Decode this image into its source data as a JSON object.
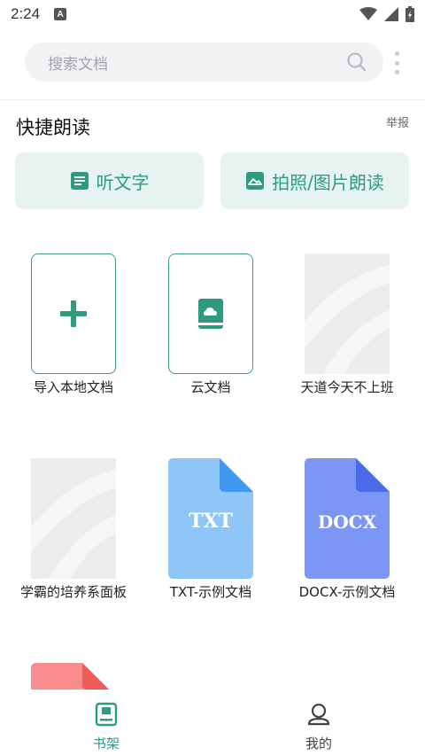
{
  "status_bar": {
    "time": "2:24",
    "notif_letter": "A"
  },
  "search": {
    "placeholder": "搜索文档"
  },
  "quick_read": {
    "title": "快捷朗读",
    "report": "举报",
    "listen_label": "听文字",
    "photo_label": "拍照/图片朗读"
  },
  "books": [
    {
      "title": "导入本地文档",
      "type": "add"
    },
    {
      "title": "云文档",
      "type": "cloud"
    },
    {
      "title": "天道今天不上班",
      "type": "blank"
    },
    {
      "title": "学霸的培养系面板",
      "type": "blank"
    },
    {
      "title": "TXT-示例文档",
      "type": "txt",
      "badge": "TXT"
    },
    {
      "title": "DOCX-示例文档",
      "type": "docx",
      "badge": "DOCX"
    }
  ],
  "nav": {
    "bookshelf": "书架",
    "mine": "我的"
  },
  "colors": {
    "accent": "#2e9b7e",
    "txt": "#8ec6f7",
    "docx": "#7b96f5",
    "pdf": "#f98c8c"
  }
}
